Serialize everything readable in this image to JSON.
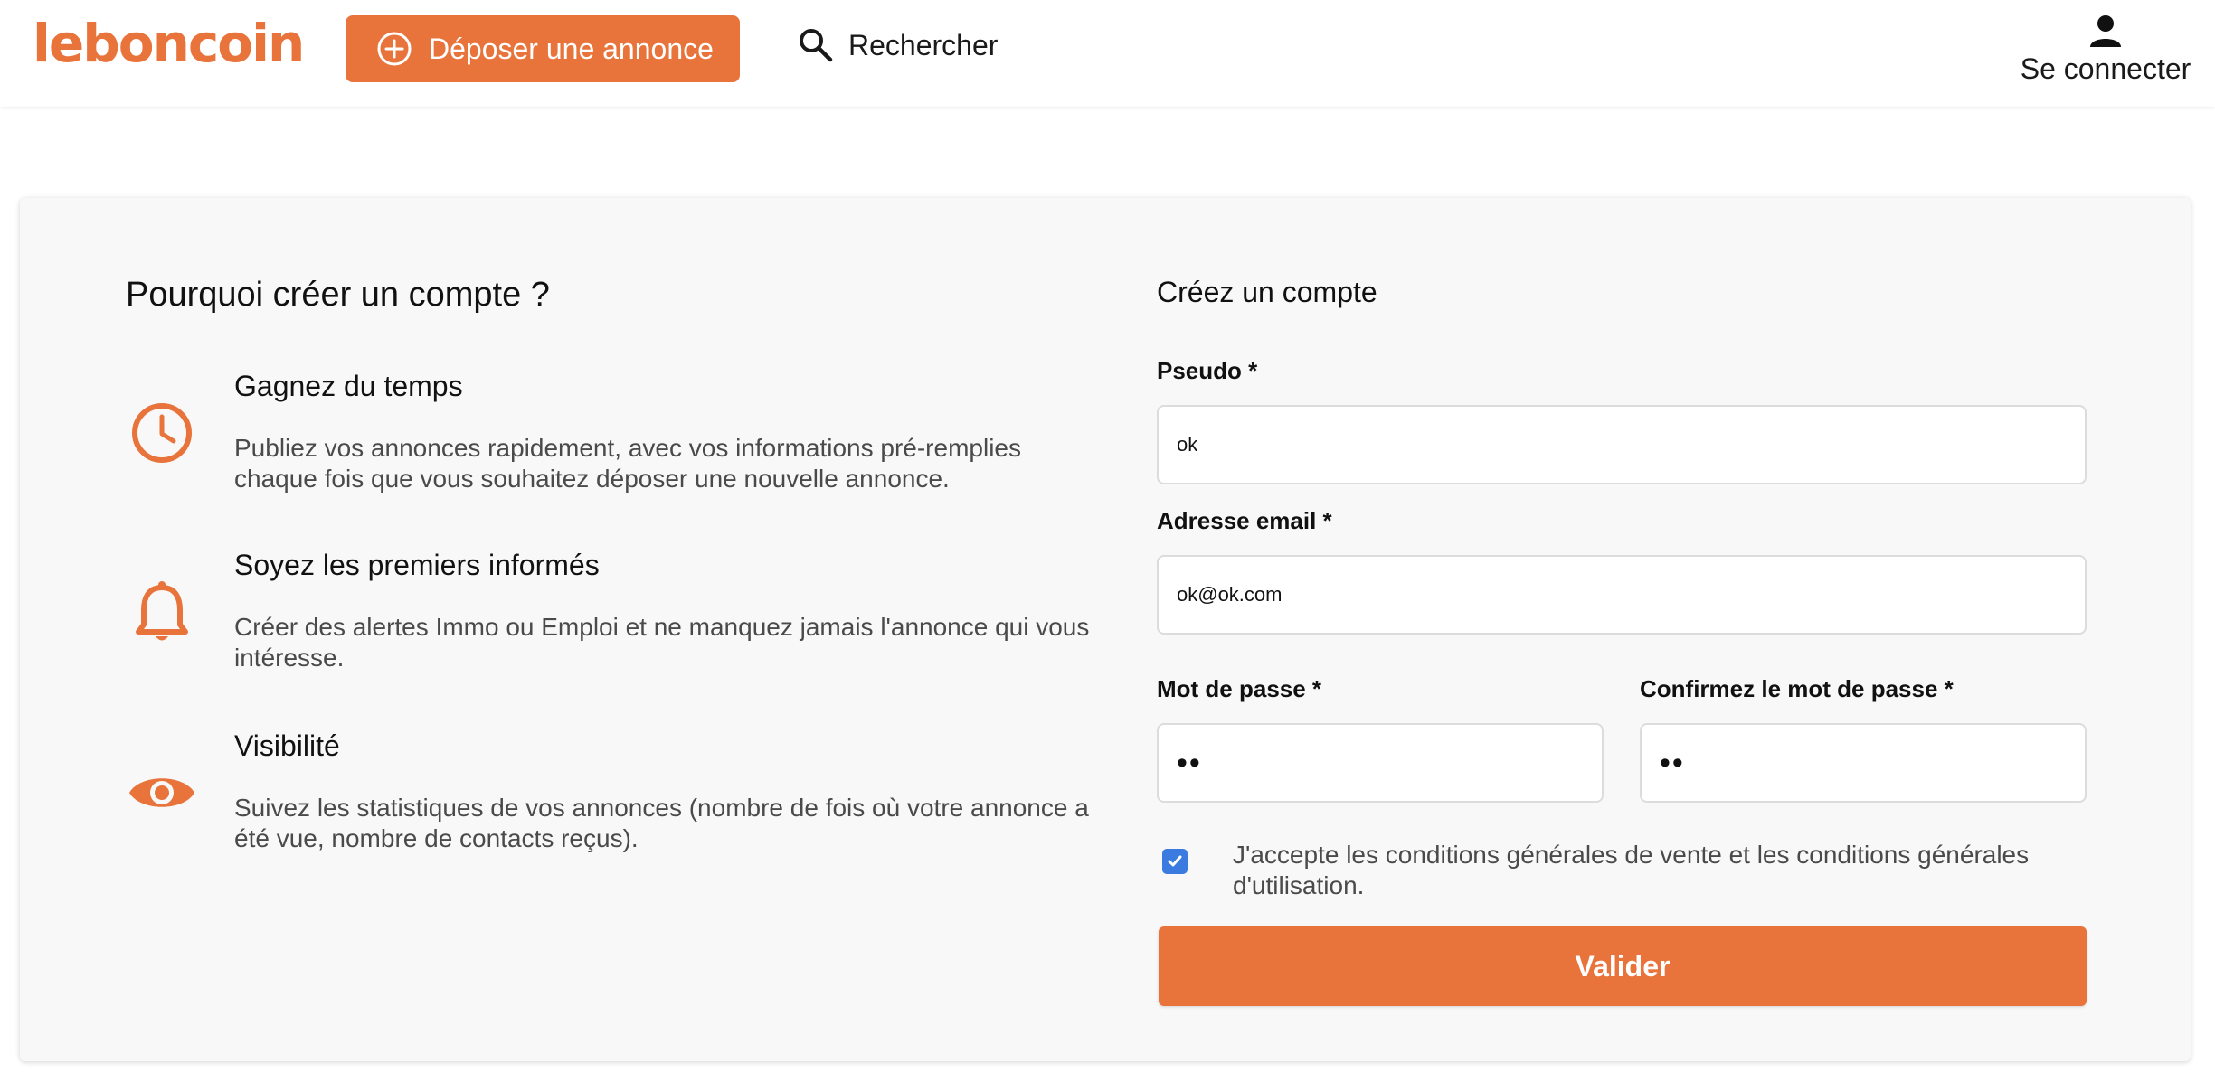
{
  "header": {
    "logo": "leboncoin",
    "post_ad_label": "Déposer une annonce",
    "search_label": "Rechercher",
    "login_label": "Se connecter"
  },
  "why": {
    "title": "Pourquoi créer un compte ?",
    "benefits": [
      {
        "icon": "clock-icon",
        "title": "Gagnez du temps",
        "description": "Publiez vos annonces rapidement, avec vos informations pré-remplies chaque fois que vous souhaitez déposer une nouvelle annonce."
      },
      {
        "icon": "bell-icon",
        "title": "Soyez les premiers informés",
        "description": "Créer des alertes Immo ou Emploi et ne manquez jamais l'annonce qui vous intéresse."
      },
      {
        "icon": "eye-icon",
        "title": "Visibilité",
        "description": "Suivez les statistiques de vos annonces (nombre de fois où votre annonce a été vue, nombre de contacts reçus)."
      }
    ]
  },
  "form": {
    "title": "Créez un compte",
    "pseudo_label": "Pseudo *",
    "pseudo_value": "ok",
    "email_label": "Adresse email *",
    "email_value": "ok@ok.com",
    "password_label": "Mot de passe *",
    "password_value": "••",
    "confirm_label": "Confirmez le mot de passe *",
    "confirm_value": "••",
    "terms_checked": true,
    "terms_text": "J'accepte les conditions générales de vente et les conditions générales d'utilisation.",
    "submit_label": "Valider"
  },
  "colors": {
    "brand": "#e8743b",
    "checkbox": "#3b7be0",
    "card_background": "#f8f8f8"
  }
}
